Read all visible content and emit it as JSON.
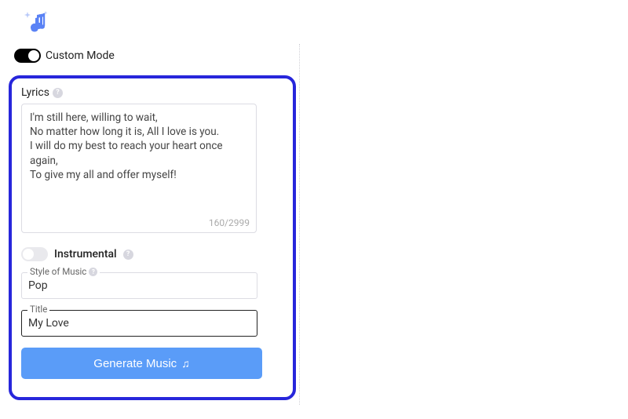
{
  "header": {
    "custom_mode_label": "Custom Mode",
    "custom_mode_on": true
  },
  "lyrics": {
    "label": "Lyrics",
    "text": "I'm still here, willing to wait,\nNo matter how long it is, All I love is you.\nI will do my best to reach your heart once again,\nTo give my all and offer myself!",
    "count": "160/2999"
  },
  "instrumental": {
    "label": "Instrumental",
    "on": false
  },
  "style": {
    "label": "Style of Music",
    "value": "Pop"
  },
  "title": {
    "label": "Title",
    "value": "My Love"
  },
  "generate_label": "Generate Music"
}
